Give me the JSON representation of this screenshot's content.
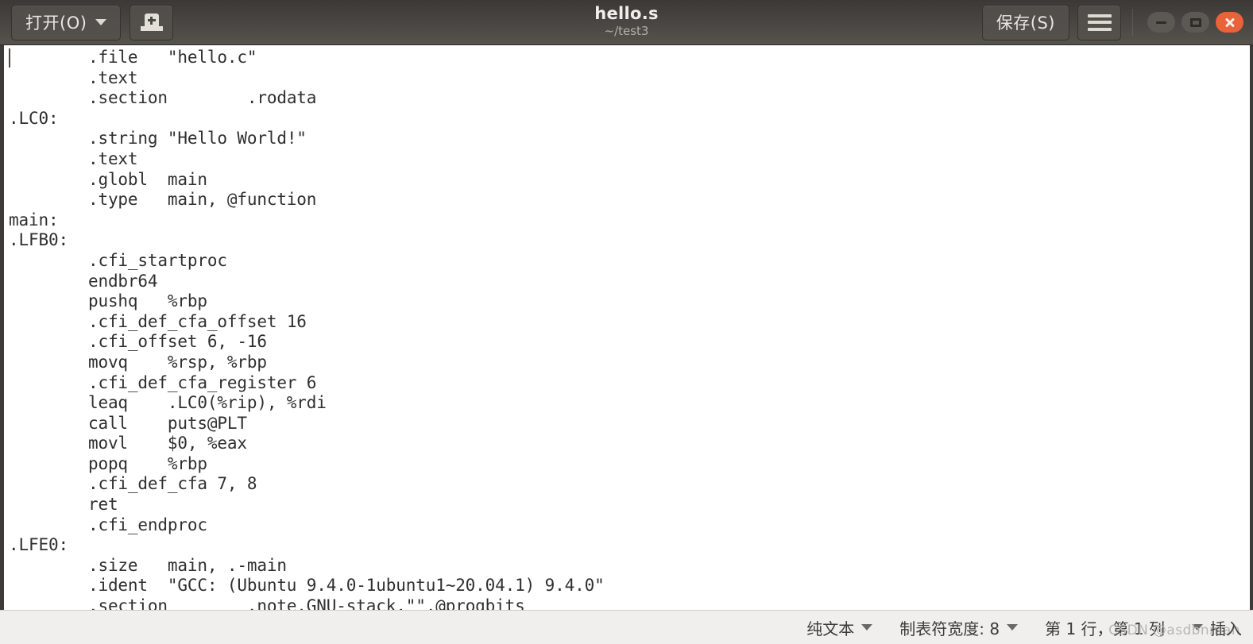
{
  "window": {
    "title": "hello.s",
    "subtitle": "~/test3",
    "controls": {
      "minimize": "minimize",
      "maximize": "maximize",
      "close": "close"
    }
  },
  "toolbar": {
    "open_label": "打开(O)",
    "open_icon": "chevron-down-icon",
    "save_as_icon": "save-as-icon",
    "save_label": "保存(S)",
    "menu_icon": "hamburger-menu-icon"
  },
  "editor": {
    "language": "assembly",
    "cursor_line": 1,
    "cursor_column": 1,
    "content": "\t.file\t\"hello.c\"\n\t.text\n\t.section\t.rodata\n.LC0:\n\t.string \"Hello World!\"\n\t.text\n\t.globl\tmain\n\t.type\tmain, @function\nmain:\n.LFB0:\n\t.cfi_startproc\n\tendbr64\n\tpushq\t%rbp\n\t.cfi_def_cfa_offset 16\n\t.cfi_offset 6, -16\n\tmovq\t%rsp, %rbp\n\t.cfi_def_cfa_register 6\n\tleaq\t.LC0(%rip), %rdi\n\tcall\tputs@PLT\n\tmovl\t$0, %eax\n\tpopq\t%rbp\n\t.cfi_def_cfa 7, 8\n\tret\n\t.cfi_endproc\n.LFE0:\n\t.size\tmain, .-main\n\t.ident\t\"GCC: (Ubuntu 9.4.0-1ubuntu1~20.04.1) 9.4.0\"\n\t.section\t.note.GNU-stack,\"\",@progbits"
  },
  "statusbar": {
    "file_type": "纯文本",
    "tab_width_label": "制表符宽度: 8",
    "position": "第 1 行，第 1 列",
    "insert_mode": "插入",
    "watermark": "CSDN @asdbnman"
  },
  "colors": {
    "titlebar_top": "#3b3936",
    "titlebar_bottom": "#56534e",
    "window_border": "#3d3a37",
    "close_button": "#e8633a",
    "statusbar_bg": "#f0efed",
    "editor_bg": "#ffffff",
    "code_text": "#2f2f2f"
  }
}
